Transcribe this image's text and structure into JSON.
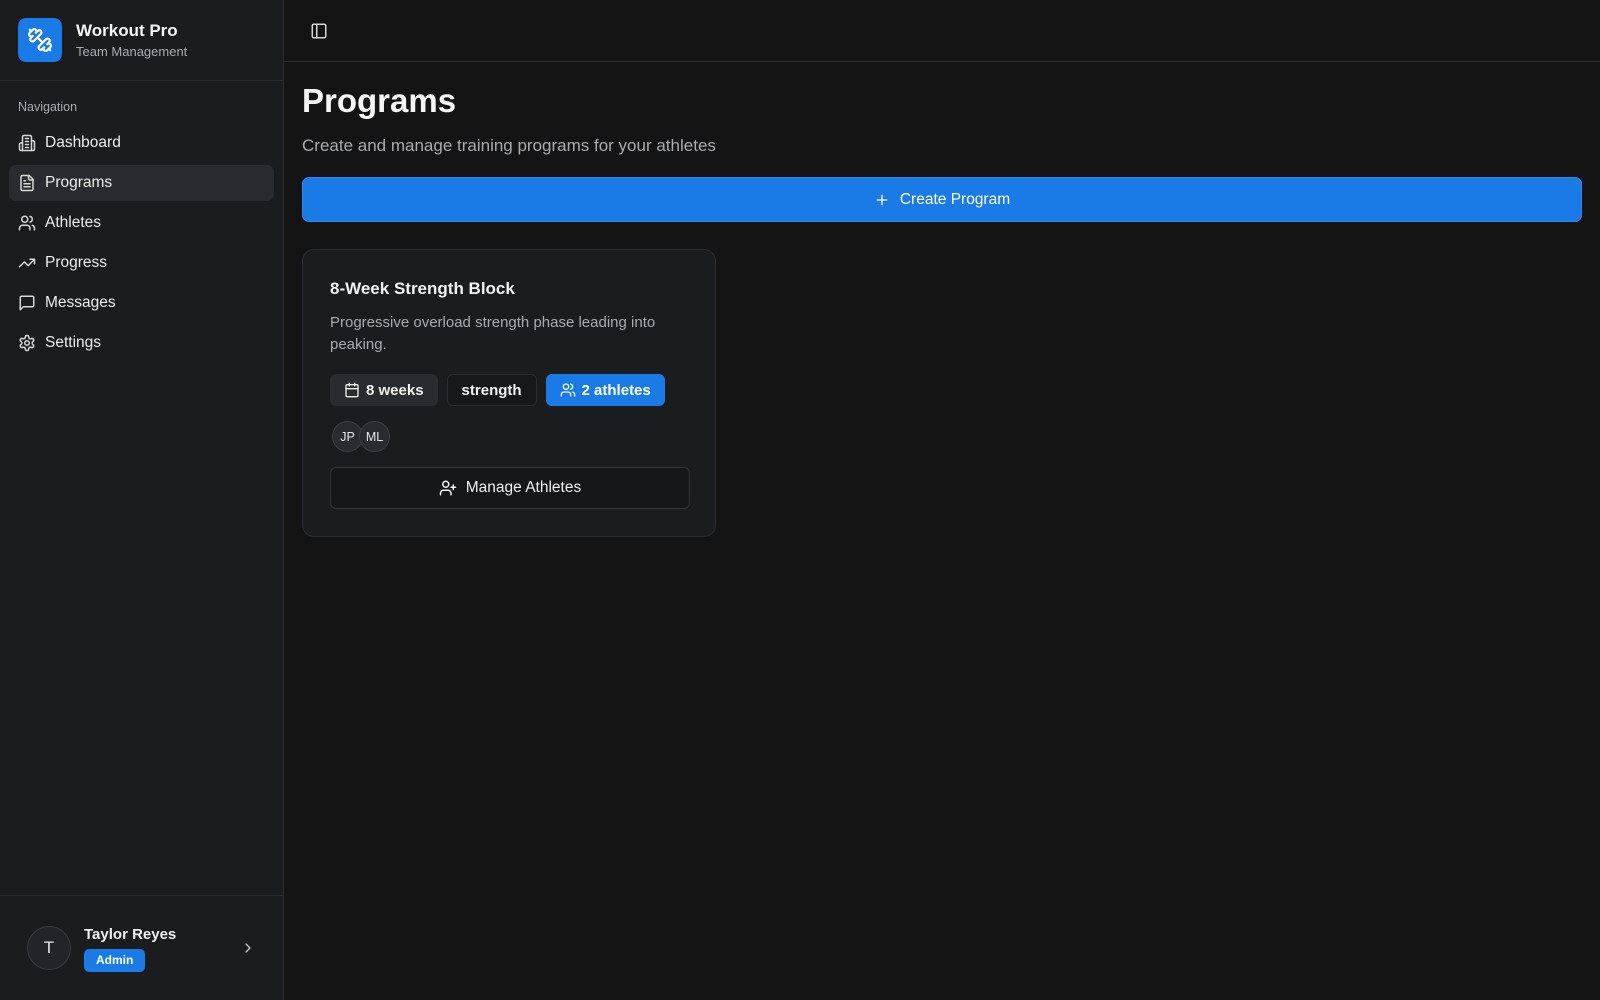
{
  "brand": {
    "title": "Workout Pro",
    "subtitle": "Team Management",
    "logo_icon": "dumbbell-icon",
    "color": "#1a7ae6"
  },
  "sidebar": {
    "heading": "Navigation",
    "items": [
      {
        "label": "Dashboard",
        "icon": "building-icon",
        "active": false
      },
      {
        "label": "Programs",
        "icon": "file-text-icon",
        "active": true
      },
      {
        "label": "Athletes",
        "icon": "users-icon",
        "active": false
      },
      {
        "label": "Progress",
        "icon": "trending-up-icon",
        "active": false
      },
      {
        "label": "Messages",
        "icon": "message-square-icon",
        "active": false
      },
      {
        "label": "Settings",
        "icon": "gear-icon",
        "active": false
      }
    ]
  },
  "user": {
    "initial": "T",
    "name": "Taylor Reyes",
    "role": "Admin"
  },
  "page": {
    "title": "Programs",
    "subtitle": "Create and manage training programs for your athletes",
    "create_label": "Create Program"
  },
  "programs": [
    {
      "title": "8-Week Strength Block",
      "description": "Progressive overload strength phase leading into peaking.",
      "duration": "8 weeks",
      "category": "strength",
      "athletes_label": "2 athletes",
      "athletes": [
        "JP",
        "ML"
      ],
      "manage_label": "Manage Athletes"
    }
  ],
  "colors": {
    "accent": "#1a7ae6",
    "background": "#141414",
    "sidebar": "#1b1c1e"
  }
}
